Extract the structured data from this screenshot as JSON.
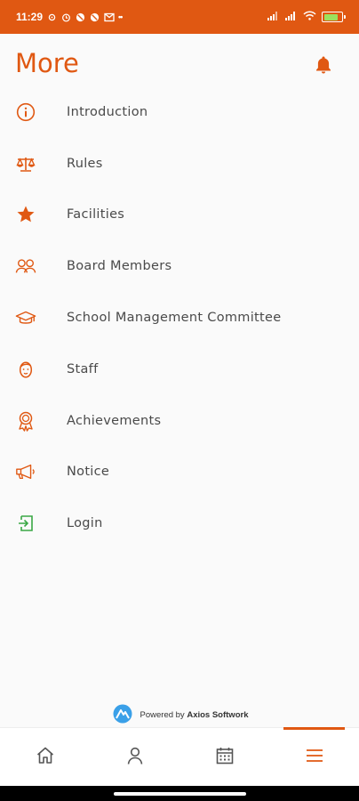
{
  "status_bar": {
    "time": "11:29",
    "notification_icons": [
      "settings-icon",
      "alarm-icon",
      "no-data-icon",
      "no-data-icon",
      "gmail-icon"
    ],
    "more_dots": "••",
    "battery_percent": 80
  },
  "header": {
    "title": "More",
    "bell_icon": "bell-icon"
  },
  "menu": {
    "items": [
      {
        "label": "Introduction",
        "icon": "info-icon",
        "color": "#e05812"
      },
      {
        "label": "Rules",
        "icon": "scales-icon",
        "color": "#e05812"
      },
      {
        "label": "Facilities",
        "icon": "star-icon",
        "color": "#e05812"
      },
      {
        "label": "Board Members",
        "icon": "group-icon",
        "color": "#e05812"
      },
      {
        "label": "School Management Committee",
        "icon": "graduation-cap-icon",
        "color": "#e05812"
      },
      {
        "label": "Staff",
        "icon": "person-face-icon",
        "color": "#e05812"
      },
      {
        "label": "Achievements",
        "icon": "award-icon",
        "color": "#e05812"
      },
      {
        "label": "Notice",
        "icon": "megaphone-icon",
        "color": "#e05812"
      },
      {
        "label": "Login",
        "icon": "login-icon",
        "color": "#3aa845"
      }
    ]
  },
  "footer": {
    "powered_prefix": "Powered by",
    "company": "Axios Softwork"
  },
  "bottom_nav": {
    "items": [
      {
        "name": "home",
        "icon": "home-icon",
        "active": false
      },
      {
        "name": "profile",
        "icon": "user-icon",
        "active": false
      },
      {
        "name": "calendar",
        "icon": "calendar-icon",
        "active": false
      },
      {
        "name": "more",
        "icon": "menu-icon",
        "active": true
      }
    ]
  },
  "colors": {
    "accent": "#e05812",
    "login_green": "#3aa845",
    "nav_icon": "#555555"
  }
}
